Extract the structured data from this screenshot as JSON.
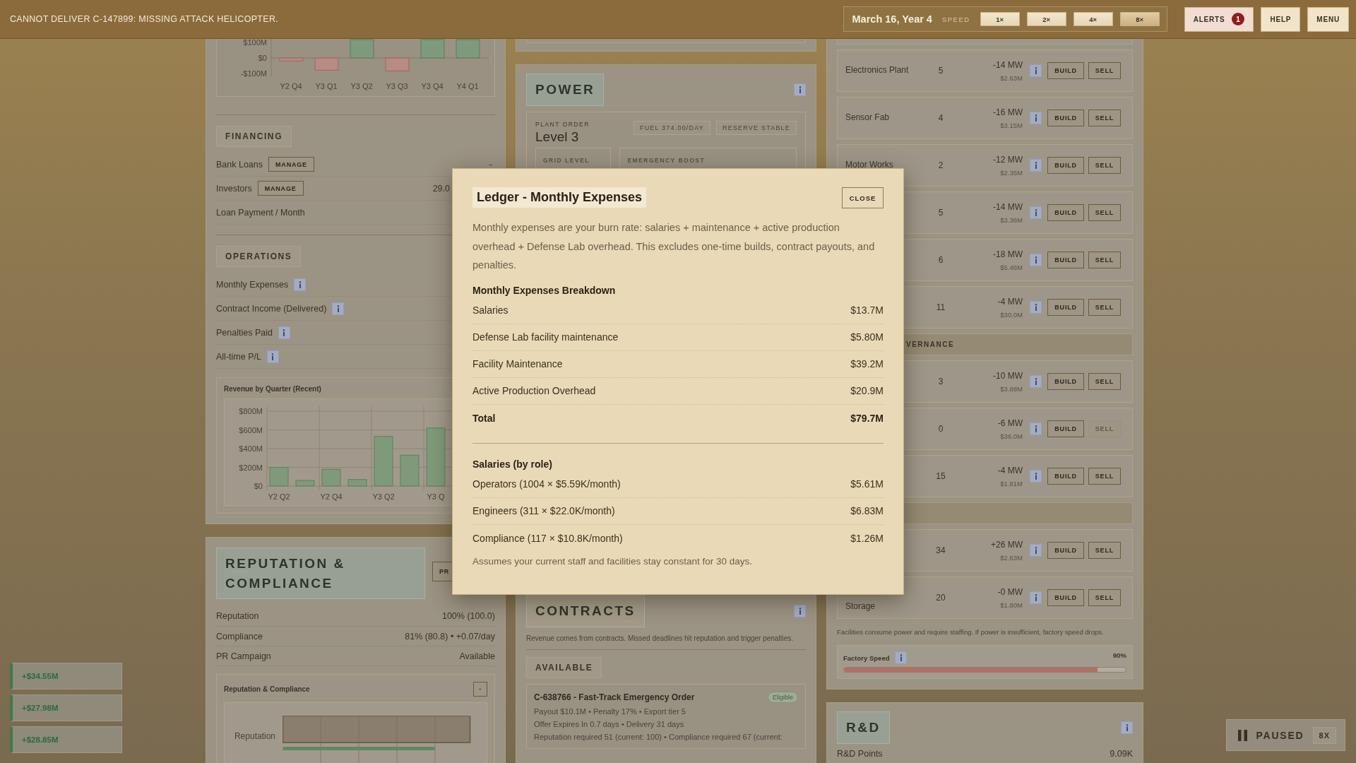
{
  "top_bar": {
    "message": "CANNOT DELIVER C-147899: MISSING ATTACK HELICOPTER.",
    "date": "March 16, Year 4",
    "speed_label": "SPEED",
    "speeds": [
      {
        "label": "1×",
        "selected": false
      },
      {
        "label": "2×",
        "selected": false
      },
      {
        "label": "4×",
        "selected": false
      },
      {
        "label": "8×",
        "selected": true
      }
    ],
    "buttons": [
      {
        "kind": "alerts",
        "label": "ALERTS",
        "count": "1"
      },
      {
        "kind": "plain",
        "label": "HELP"
      },
      {
        "kind": "plain",
        "label": "MENU"
      }
    ]
  },
  "finance_panel": {
    "pl_chart": {
      "chart_data": {
        "type": "bar",
        "categories": [
          "Y2 Q4",
          "Y3 Q1",
          "Y3 Q2",
          "Y3 Q3",
          "Y3 Q4",
          "Y4 Q1"
        ],
        "values": [
          -20,
          -80,
          120,
          -85,
          120,
          120
        ],
        "ylim": [
          -120,
          125
        ],
        "yticks": [
          {
            "value": 100,
            "label": "$100M"
          },
          {
            "value": 0,
            "label": "$0"
          },
          {
            "value": -100,
            "label": "-$100M"
          }
        ]
      }
    },
    "financing": {
      "title": "FINANCING",
      "rows": [
        {
          "label": "Bank Loans",
          "action": "MANAGE",
          "value": "-"
        },
        {
          "label": "Investors",
          "action": "MANAGE",
          "value": "29.0"
        },
        {
          "label": "Loan Payment / Month"
        }
      ]
    },
    "operations": {
      "title": "OPERATIONS",
      "rows": [
        {
          "label": "Monthly Expenses"
        },
        {
          "label": "Contract Income (Delivered)"
        },
        {
          "label": "Penalties Paid"
        },
        {
          "label": "All-time P/L"
        }
      ]
    },
    "revenue_chart": {
      "title": "Revenue by Quarter (Recent)",
      "chart_data": {
        "type": "bar",
        "categories": [
          "Y2 Q2",
          null,
          "Y2 Q4",
          null,
          "Y3 Q2",
          null,
          "Y3 Q"
        ],
        "values": [
          200,
          60,
          180,
          70,
          530,
          330,
          620
        ],
        "ylim": [
          0,
          800
        ],
        "grid": true,
        "yticks": [
          {
            "value": 0,
            "label": "$0"
          },
          {
            "value": 200,
            "label": "$200M"
          },
          {
            "value": 400,
            "label": "$400M"
          },
          {
            "value": 600,
            "label": "$600M"
          },
          {
            "value": 800,
            "label": "$800M"
          }
        ]
      }
    }
  },
  "reputation_panel": {
    "title": "REPUTATION & COMPLIANCE",
    "action": "PR",
    "rows": [
      {
        "label": "Reputation",
        "value": "100% (100.0)"
      },
      {
        "label": "Compliance",
        "value": "81% (80.8) • +0.07/day"
      },
      {
        "label": "PR Campaign",
        "value": "Available"
      }
    ],
    "chart": {
      "title": "Reputation & Compliance",
      "toggle": "-",
      "bar_label": "Reputation"
    }
  },
  "power_panel": {
    "title": "POWER",
    "plant_order": {
      "label": "PLANT ORDER",
      "value": "Level 3",
      "tags": [
        "FUEL 374.00/DAY",
        "RESERVE STABLE"
      ]
    },
    "boxes": [
      "GRID LEVEL",
      "EMERGENCY BOOST"
    ]
  },
  "contracts_panel": {
    "title": "CONTRACTS",
    "description": "Revenue comes from contracts. Missed deadlines hit reputation and trigger penalties.",
    "section": "AVAILABLE",
    "contract": {
      "title": "C-638766 - Fast-Track Emergency Order",
      "badge": "Eligible",
      "lines": [
        "Payout $10.1M • Penalty 17% • Export tier 5",
        "Offer Expires In 0.7 days • Delivery 31 days",
        "Reputation required 51 (current: 100) • Compliance required 67 (current:"
      ]
    }
  },
  "facilities_panel": {
    "items": [
      {
        "kind": "facility",
        "name": "Electronics Plant",
        "count": "5",
        "power": "-14 MW",
        "cost": "$2.63M",
        "build": "BUILD",
        "sell": "SELL",
        "sell_enabled": true
      },
      {
        "kind": "facility",
        "name": "Sensor Fab",
        "count": "4",
        "power": "-16 MW",
        "cost": "$3.15M",
        "build": "BUILD",
        "sell": "SELL",
        "sell_enabled": true
      },
      {
        "kind": "facility",
        "name": "Motor Works",
        "count": "2",
        "power": "-12 MW",
        "cost": "$2.35M",
        "build": "BUILD",
        "sell": "SELL",
        "sell_enabled": true
      },
      {
        "kind": "facility",
        "count": "5",
        "power": "-14 MW",
        "cost": "$3.36M",
        "build": "BUILD",
        "sell": "SELL",
        "sell_enabled": true
      },
      {
        "kind": "facility",
        "count": "6",
        "power": "-18 MW",
        "cost": "$5.46M",
        "build": "BUILD",
        "sell": "SELL",
        "sell_enabled": true
      },
      {
        "kind": "facility",
        "count": "11",
        "power": "-4 MW",
        "cost": "$30.0M",
        "build": "BUILD",
        "sell": "SELL",
        "sell_enabled": true
      },
      {
        "kind": "section",
        "label": "VERNANCE"
      },
      {
        "kind": "facility",
        "count": "3",
        "power": "-10 MW",
        "cost": "$3.88M",
        "build": "BUILD",
        "sell": "SELL",
        "sell_enabled": true
      },
      {
        "kind": "facility",
        "count": "0",
        "power": "-6 MW",
        "cost": "$36.0M",
        "build": "BUILD",
        "sell": "SELL",
        "sell_enabled": false
      },
      {
        "kind": "facility",
        "count": "15",
        "power": "-4 MW",
        "cost": "$1.81M",
        "build": "BUILD",
        "sell": "SELL",
        "sell_enabled": true
      },
      {
        "kind": "section"
      },
      {
        "kind": "facility",
        "count": "34",
        "power": "+26 MW",
        "cost": "$2.63M",
        "build": "BUILD",
        "sell": "SELL",
        "sell_enabled": true
      },
      {
        "kind": "facility",
        "name": "Storage",
        "count": "20",
        "power": "-0 MW",
        "cost": "$1.80M",
        "build": "BUILD",
        "sell": "SELL",
        "sell_enabled": true
      }
    ],
    "note": "Facilities consume power and require staffing. If power is insufficient, factory speed drops.",
    "factory_speed": {
      "label": "Factory Speed",
      "reading": "90%",
      "level": 0.9
    }
  },
  "rd_panel": {
    "title": "R&D",
    "rows": [
      {
        "label": "R&D Points",
        "value": "9.09K"
      }
    ]
  },
  "toasts": [
    "+$34.55M",
    "+$27.98M",
    "+$28.85M"
  ],
  "pause": {
    "label": "PAUSED",
    "speed": "8X"
  },
  "modal": {
    "title": "Ledger - Monthly Expenses",
    "close": "CLOSE",
    "description": "Monthly expenses are your burn rate: salaries + maintenance + active production overhead + Defense Lab overhead. This excludes one-time builds, contract payouts, and penalties.",
    "sections": [
      {
        "heading": "Monthly Expenses Breakdown",
        "rows": [
          {
            "kind": "item",
            "label": "Salaries",
            "value": "$13.7M"
          },
          {
            "kind": "item",
            "label": "Defense Lab facility maintenance",
            "value": "$5.80M"
          },
          {
            "kind": "item",
            "label": "Facility Maintenance",
            "value": "$39.2M"
          },
          {
            "kind": "item",
            "label": "Active Production Overhead",
            "value": "$20.9M"
          },
          {
            "kind": "total",
            "label": "Total",
            "value": "$79.7M"
          }
        ]
      },
      {
        "heading": "Salaries (by role)",
        "rows": [
          {
            "kind": "item",
            "label": "Operators (1004 × $5.59K/month)",
            "value": "$5.61M"
          },
          {
            "kind": "item",
            "label": "Engineers (311 × $22.0K/month)",
            "value": "$6.83M"
          },
          {
            "kind": "item",
            "label": "Compliance (117 × $10.8K/month)",
            "value": "$1.26M"
          }
        ]
      }
    ],
    "footnote": "Assumes your current staff and facilities stay constant for 30 days."
  }
}
